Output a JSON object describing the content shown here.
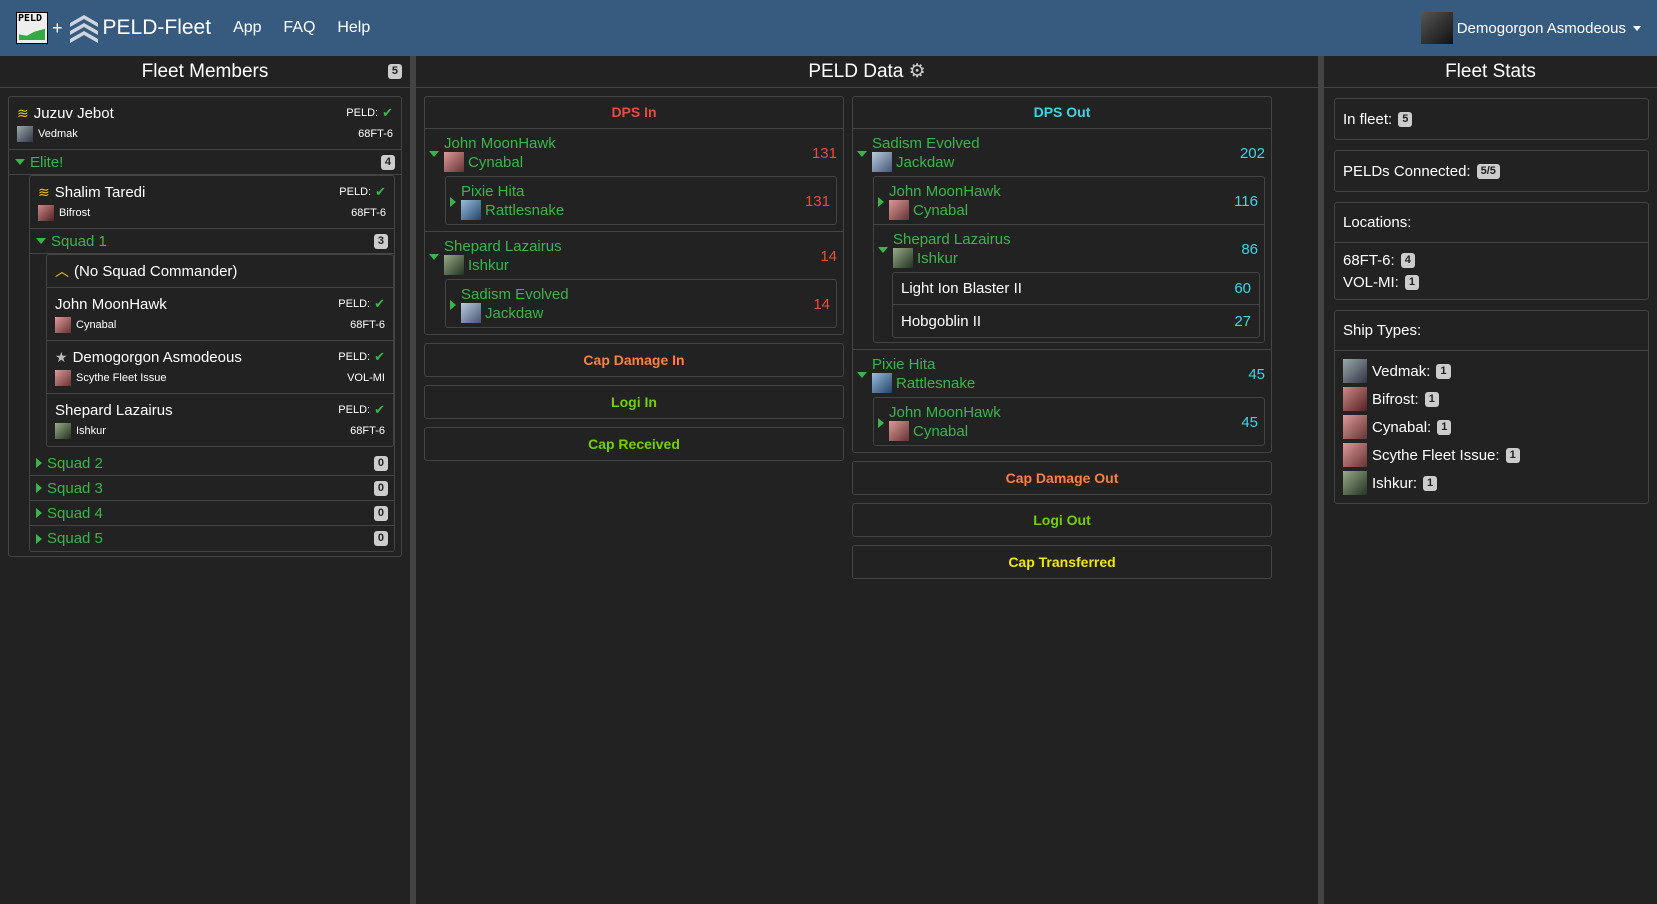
{
  "nav": {
    "logo_text": "PELD",
    "plus": "+",
    "brand": "PELD-Fleet",
    "links": [
      "App",
      "FAQ",
      "Help"
    ],
    "user": "Demogorgon Asmodeous"
  },
  "fleet": {
    "title": "Fleet Members",
    "count": "5",
    "commander": {
      "name": "Juzuv Jebot",
      "peld": "PELD:",
      "ship": "Vedmak",
      "system": "68FT-6"
    },
    "wing": {
      "name": "Elite!",
      "count": "4",
      "commander": {
        "name": "Shalim Taredi",
        "peld": "PELD:",
        "ship": "Bifrost",
        "system": "68FT-6"
      },
      "squad1": {
        "name": "Squad 1",
        "count": "3",
        "nocmd": "(No Squad Commander)",
        "members": [
          {
            "name": "John MoonHawk",
            "peld": "PELD:",
            "ship": "Cynabal",
            "system": "68FT-6"
          },
          {
            "name": "Demogorgon Asmodeous",
            "peld": "PELD:",
            "ship": "Scythe Fleet Issue",
            "system": "VOL-MI"
          },
          {
            "name": "Shepard Lazairus",
            "peld": "PELD:",
            "ship": "Ishkur",
            "system": "68FT-6"
          }
        ]
      },
      "squads": [
        {
          "name": "Squad 2",
          "count": "0"
        },
        {
          "name": "Squad 3",
          "count": "0"
        },
        {
          "name": "Squad 4",
          "count": "0"
        },
        {
          "name": "Squad 5",
          "count": "0"
        }
      ]
    }
  },
  "peld": {
    "title": "PELD Data",
    "dps_in": {
      "title": "DPS In",
      "groups": [
        {
          "name": "John MoonHawk",
          "ship": "Cynabal",
          "value": "131",
          "sub": {
            "name": "Pixie Hita",
            "ship": "Rattlesnake",
            "value": "131"
          }
        },
        {
          "name": "Shepard Lazairus",
          "ship": "Ishkur",
          "value": "14",
          "sub": {
            "name": "Sadism Evolved",
            "ship": "Jackdaw",
            "value": "14"
          }
        }
      ]
    },
    "dps_out": {
      "title": "DPS Out",
      "g1": {
        "name": "Sadism Evolved",
        "ship": "Jackdaw",
        "value": "202",
        "sub1": {
          "name": "John MoonHawk",
          "ship": "Cynabal",
          "value": "116"
        },
        "sub2": {
          "name": "Shepard Lazairus",
          "ship": "Ishkur",
          "value": "86",
          "weapons": [
            {
              "name": "Light Ion Blaster II",
              "value": "60"
            },
            {
              "name": "Hobgoblin II",
              "value": "27"
            }
          ]
        }
      },
      "g2": {
        "name": "Pixie Hita",
        "ship": "Rattlesnake",
        "value": "45",
        "sub": {
          "name": "John MoonHawk",
          "ship": "Cynabal",
          "value": "45"
        }
      }
    },
    "left_buttons": [
      "Cap Damage In",
      "Logi In",
      "Cap Received"
    ],
    "right_buttons": [
      "Cap Damage Out",
      "Logi Out",
      "Cap Transferred"
    ]
  },
  "stats": {
    "title": "Fleet Stats",
    "in_fleet_label": "In fleet:",
    "in_fleet": "5",
    "pelds_label": "PELDs Connected:",
    "pelds": "5/5",
    "locations_label": "Locations:",
    "locations": [
      {
        "name": "68FT-6:",
        "count": "4"
      },
      {
        "name": "VOL-MI:",
        "count": "1"
      }
    ],
    "ship_types_label": "Ship Types:",
    "ship_types": [
      {
        "name": "Vedmak:",
        "count": "1"
      },
      {
        "name": "Bifrost:",
        "count": "1"
      },
      {
        "name": "Cynabal:",
        "count": "1"
      },
      {
        "name": "Scythe Fleet Issue:",
        "count": "1"
      },
      {
        "name": "Ishkur:",
        "count": "1"
      }
    ]
  },
  "colors": {
    "navbar": "#375a7f",
    "background": "#222222",
    "green": "#39b54a",
    "dps_in": "#e74c3c",
    "dps_out": "#3bd6e6",
    "cap_damage": "#ff7f3f",
    "logi": "#74d100",
    "cap": "#f0e800",
    "gold": "#f1c40f"
  }
}
